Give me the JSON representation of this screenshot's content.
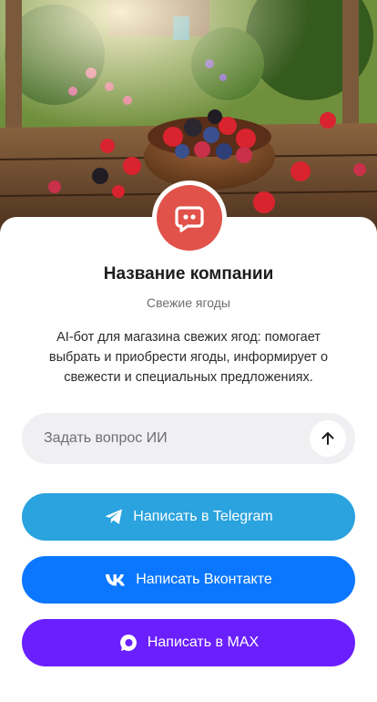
{
  "company": {
    "name": "Название компании",
    "tagline": "Свежие ягоды",
    "description": "AI-бот для магазина свежих ягод: помогает выбрать и приобрести ягоды, информирует о свежести и специальных предложениях."
  },
  "hero": {
    "image_subject": "bowl of fresh berries on a wooden garden table"
  },
  "logo": {
    "icon": "chat-bubble-icon",
    "color": "#e0524a"
  },
  "ask": {
    "placeholder": "Задать вопрос ИИ",
    "send_icon": "arrow-up-icon"
  },
  "buttons": [
    {
      "label": "Написать в Telegram",
      "icon": "telegram-icon",
      "color": "#2aa3df"
    },
    {
      "label": "Написать Вконтакте",
      "icon": "vk-icon",
      "color": "#0b77ff"
    },
    {
      "label": "Написать в MAX",
      "icon": "max-icon",
      "color": "#6a1fff"
    }
  ]
}
